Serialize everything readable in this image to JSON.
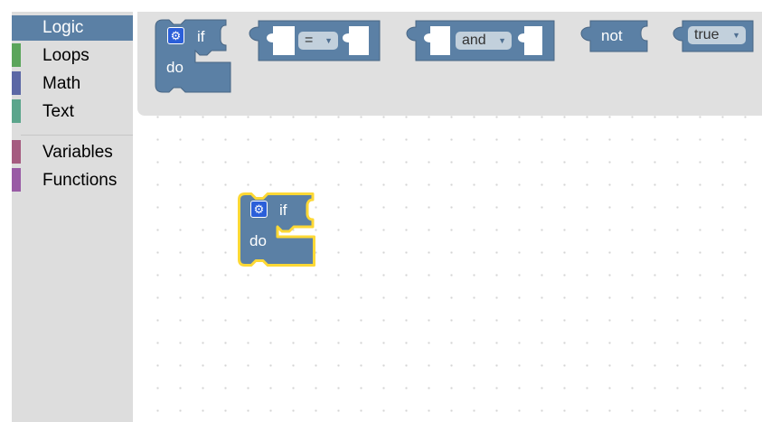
{
  "toolbox": {
    "categories": [
      {
        "label": "Logic",
        "color": "#5b80a5",
        "selected": true
      },
      {
        "label": "Loops",
        "color": "#5ba55b"
      },
      {
        "label": "Math",
        "color": "#5b67a5"
      },
      {
        "label": "Text",
        "color": "#5ba58c"
      },
      {
        "label": "Variables",
        "color": "#a55b80"
      },
      {
        "label": "Functions",
        "color": "#995ba5"
      }
    ]
  },
  "flyout": {
    "if_block": {
      "if_label": "if",
      "do_label": "do",
      "gear": "gear-icon"
    },
    "compare_block": {
      "operator": "="
    },
    "operation_block": {
      "operator": "and"
    },
    "negate_block": {
      "label": "not"
    },
    "boolean_block": {
      "value": "true"
    }
  },
  "workspace": {
    "if_block": {
      "if_label": "if",
      "do_label": "do",
      "selected": true,
      "highlight_color": "#fdd835"
    }
  },
  "colors": {
    "block": "#5b80a5",
    "block_dark": "#496684",
    "toolbox_bg": "#dddddd",
    "flyout_bg": "#e0e0e0"
  }
}
